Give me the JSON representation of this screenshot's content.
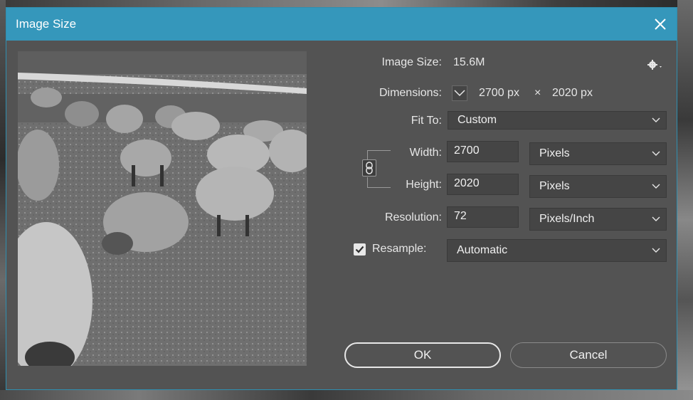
{
  "dialog": {
    "title": "Image Size",
    "close_icon": "close-icon"
  },
  "info": {
    "image_size_label": "Image Size:",
    "image_size_value": "15.6M",
    "dimensions_label": "Dimensions:",
    "dimensions_width": "2700 px",
    "dimensions_times": "×",
    "dimensions_height": "2020 px"
  },
  "fit_to": {
    "label": "Fit To:",
    "value": "Custom"
  },
  "width": {
    "label": "Width:",
    "value": "2700",
    "unit": "Pixels"
  },
  "height": {
    "label": "Height:",
    "value": "2020",
    "unit": "Pixels"
  },
  "resolution": {
    "label": "Resolution:",
    "value": "72",
    "unit": "Pixels/Inch"
  },
  "resample": {
    "label": "Resample:",
    "checked": true,
    "value": "Automatic"
  },
  "buttons": {
    "ok": "OK",
    "cancel": "Cancel"
  },
  "colors": {
    "titlebar": "#3597bb",
    "panel": "#535353",
    "field": "#454545"
  }
}
